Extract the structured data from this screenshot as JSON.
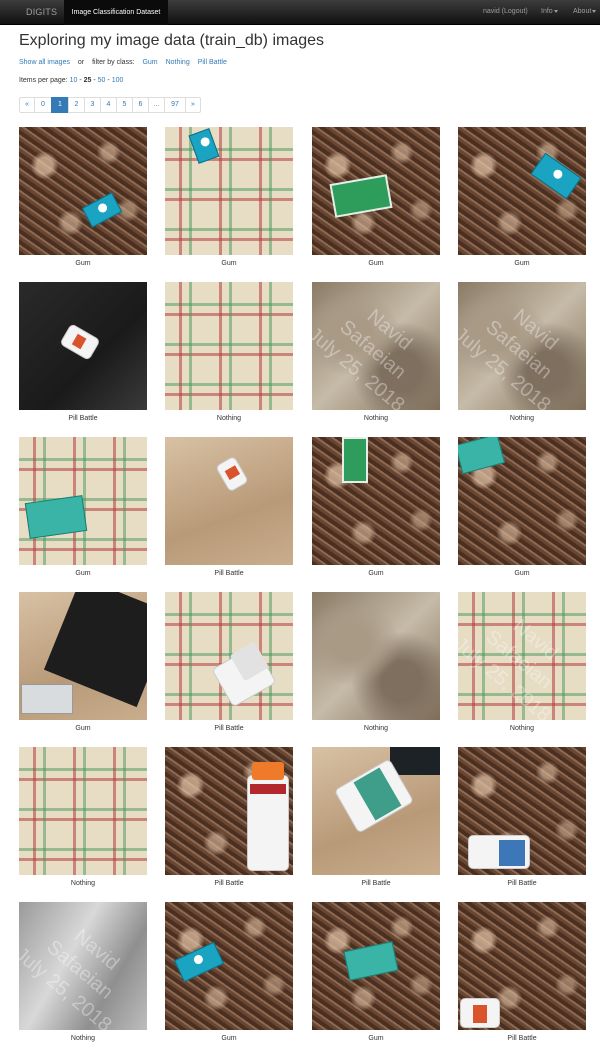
{
  "navbar": {
    "brand": "DIGITS",
    "active_item": "Image Classification Dataset",
    "user": "navid (Logout)",
    "info": "Info",
    "about": "About"
  },
  "page": {
    "title": "Exploring my image data (train_db) images",
    "show_all": "Show all images",
    "or": "or",
    "filter_label": "filter by class:",
    "filters": [
      "Gum",
      "Nothing",
      "Pill Battle"
    ],
    "items_per_page_label": "Items per page:",
    "items_per_page": [
      "10",
      "25",
      "50",
      "100"
    ],
    "items_per_page_selected": "25"
  },
  "pagination": [
    "«",
    "0",
    "1",
    "2",
    "3",
    "4",
    "5",
    "6",
    "...",
    "97",
    "»"
  ],
  "pagination_active": "1",
  "watermark": [
    "Navid Safaeian",
    "July 25, 2018"
  ],
  "tiles": [
    {
      "caption": "Gum"
    },
    {
      "caption": "Gum"
    },
    {
      "caption": "Gum"
    },
    {
      "caption": "Gum"
    },
    {
      "caption": "Pill Battle"
    },
    {
      "caption": "Nothing"
    },
    {
      "caption": "Nothing"
    },
    {
      "caption": "Nothing"
    },
    {
      "caption": "Gum"
    },
    {
      "caption": "Pill Battle"
    },
    {
      "caption": "Gum"
    },
    {
      "caption": "Gum"
    },
    {
      "caption": "Gum"
    },
    {
      "caption": "Pill Battle"
    },
    {
      "caption": "Nothing"
    },
    {
      "caption": "Nothing"
    },
    {
      "caption": "Nothing"
    },
    {
      "caption": "Pill Battle"
    },
    {
      "caption": "Pill Battle"
    },
    {
      "caption": "Pill Battle"
    },
    {
      "caption": "Nothing"
    },
    {
      "caption": "Gum"
    },
    {
      "caption": "Gum"
    },
    {
      "caption": "Pill Battle"
    }
  ]
}
